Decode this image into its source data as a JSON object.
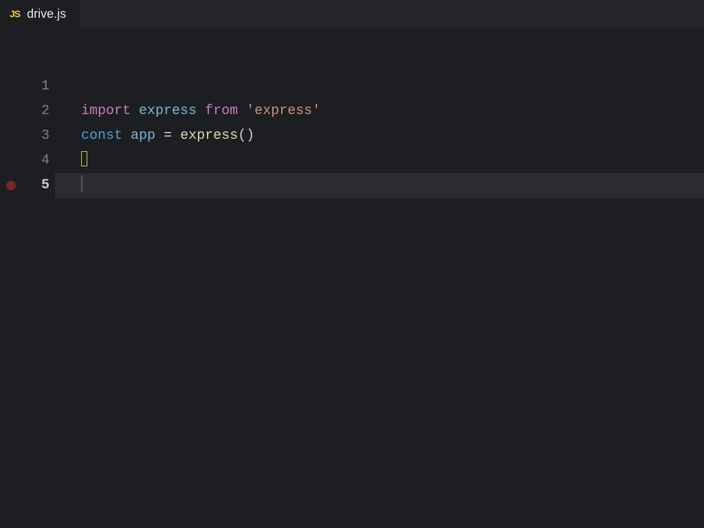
{
  "tab": {
    "icon_text": "JS",
    "filename": "drive.js"
  },
  "editor": {
    "lines": [
      {
        "num": "1",
        "tokens": []
      },
      {
        "num": "2",
        "tokens": [
          {
            "t": "import",
            "c": "kw-import"
          },
          {
            "t": " ",
            "c": ""
          },
          {
            "t": "express",
            "c": "ident"
          },
          {
            "t": " ",
            "c": ""
          },
          {
            "t": "from",
            "c": "kw-from"
          },
          {
            "t": " ",
            "c": ""
          },
          {
            "t": "'express'",
            "c": "str"
          }
        ]
      },
      {
        "num": "3",
        "tokens": [
          {
            "t": "const",
            "c": "kw-const"
          },
          {
            "t": " ",
            "c": ""
          },
          {
            "t": "app",
            "c": "var-name"
          },
          {
            "t": " ",
            "c": ""
          },
          {
            "t": "=",
            "c": "op"
          },
          {
            "t": " ",
            "c": ""
          },
          {
            "t": "express",
            "c": "func"
          },
          {
            "t": "()",
            "c": "punct"
          }
        ]
      },
      {
        "num": "4",
        "tokens": [],
        "cursor_box": true
      },
      {
        "num": "5",
        "tokens": [],
        "current": true,
        "breakpoint": true,
        "thin_cursor": true
      }
    ]
  }
}
